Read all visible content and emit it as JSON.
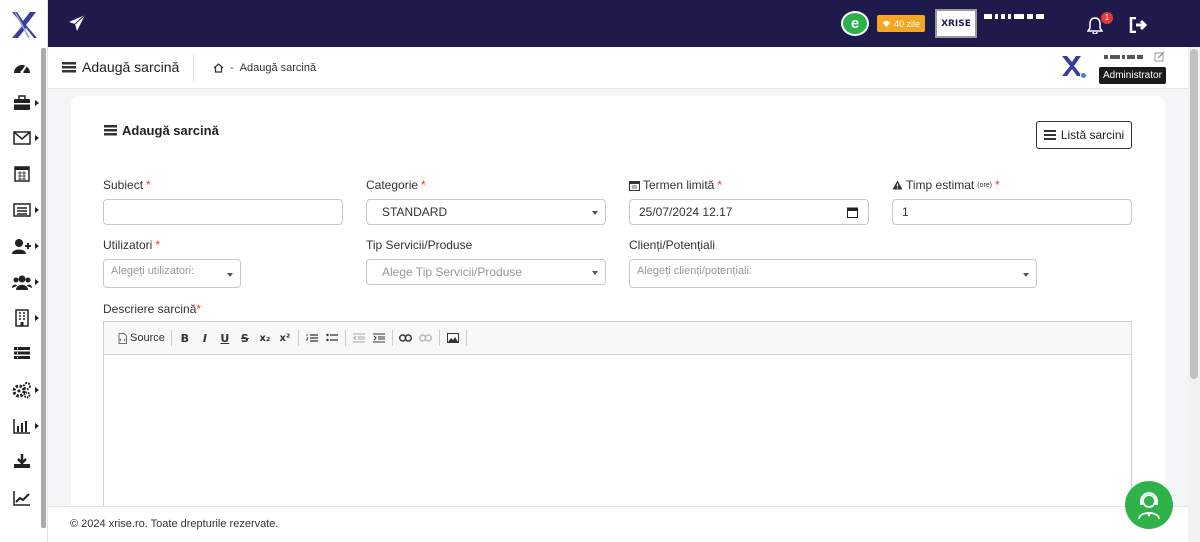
{
  "colors": {
    "topbar": "#1e1a4b",
    "accent_green": "#2bb24c",
    "badge_orange": "#f5a623",
    "required": "#e53935"
  },
  "topbar": {
    "days_badge": "40 zile",
    "brand_text": "XRISE",
    "notification_count": "1"
  },
  "sidebar": {
    "items": [
      {
        "icon": "dashboard-icon"
      },
      {
        "icon": "briefcase-icon"
      },
      {
        "icon": "envelope-icon"
      },
      {
        "icon": "calendar-icon"
      },
      {
        "icon": "list-icon"
      },
      {
        "icon": "add-user-icon"
      },
      {
        "icon": "users-icon"
      },
      {
        "icon": "building-icon"
      },
      {
        "icon": "tasks-icon"
      },
      {
        "icon": "cogs-icon"
      },
      {
        "icon": "bar-chart-icon"
      },
      {
        "icon": "download-icon"
      },
      {
        "icon": "line-chart-icon"
      }
    ]
  },
  "header": {
    "title": "Adaugă sarcină",
    "breadcrumb_sep": "-",
    "breadcrumb_current": "Adaugă sarcină",
    "role_tooltip": "Administrator"
  },
  "form": {
    "title": "Adaugă sarcină",
    "list_button": "Listă sarcini",
    "subject": {
      "label": "Subiect",
      "required": "*",
      "value": ""
    },
    "category": {
      "label": "Categorie",
      "required": "*",
      "value": "STANDARD"
    },
    "deadline": {
      "label": "Termen limită",
      "required": "*",
      "value": "25/07/2024 12.17"
    },
    "estimated_time": {
      "label": "Timp estimat",
      "unit": "(ore)",
      "required": "*",
      "value": "1"
    },
    "users": {
      "label": "Utilizatori",
      "required": "*",
      "placeholder": "Alegeți utilizatori:"
    },
    "service_type": {
      "label": "Tip Servicii/Produse",
      "placeholder": "Alege Tip Servicii/Produse"
    },
    "clients": {
      "label": "Clienți/Potențiali",
      "placeholder": "Alegeți clienți/potențiali:"
    },
    "description": {
      "label": "Descriere sarcină",
      "required": "*"
    },
    "toolbar": {
      "source": "Source",
      "bold": "B",
      "italic": "I",
      "underline": "U",
      "strike": "S",
      "subscript": "x₂",
      "superscript": "x²"
    }
  },
  "footer": {
    "text": "© 2024 xrise.ro. Toate drepturile rezervate."
  }
}
